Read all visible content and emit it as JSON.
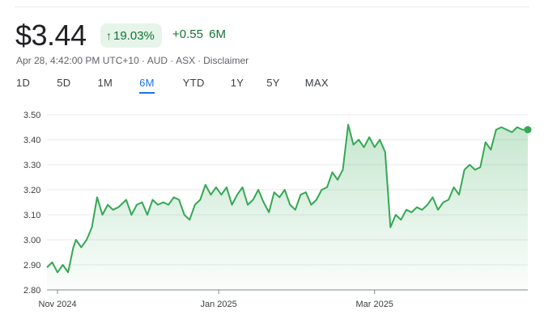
{
  "quote": {
    "price": "$3.44",
    "change_pct": "19.03%",
    "change_abs": "+0.55",
    "change_period": "6M",
    "timestamp": "Apr 28, 4:42:00 PM UTC+10",
    "currency": "AUD",
    "exchange": "ASX",
    "disclaimer": "Disclaimer",
    "up_arrow_icon": "arrow-up-icon"
  },
  "ranges": [
    {
      "label": "1D",
      "active": false
    },
    {
      "label": "5D",
      "active": false
    },
    {
      "label": "1M",
      "active": false
    },
    {
      "label": "6M",
      "active": true
    },
    {
      "label": "YTD",
      "active": false
    },
    {
      "label": "1Y",
      "active": false
    },
    {
      "label": "5Y",
      "active": false
    },
    {
      "label": "MAX",
      "active": false
    }
  ],
  "colors": {
    "line": "#34a853",
    "positive_text": "#137333",
    "badge_bg": "#e6f4ea",
    "active_tab": "#1a73e8",
    "grid": "#e8eaed"
  },
  "chart_data": {
    "type": "area",
    "ylim": [
      2.8,
      3.5
    ],
    "y_ticks": [
      "3.50",
      "3.40",
      "3.30",
      "3.20",
      "3.10",
      "3.00",
      "2.90",
      "2.80"
    ],
    "x_ticks": [
      {
        "label": "Nov 2024",
        "x": "2024-11-01"
      },
      {
        "label": "Jan 2025",
        "x": "2025-01-01"
      },
      {
        "label": "Mar 2025",
        "x": "2025-03-01"
      }
    ],
    "grid": "horizontal",
    "x_start": "2024-10-28",
    "x_end": "2025-04-28",
    "series": [
      {
        "x": [
          "2024-10-28",
          "2024-10-30",
          "2024-11-01",
          "2024-11-03",
          "2024-11-05",
          "2024-11-07",
          "2024-11-08",
          "2024-11-10",
          "2024-11-12",
          "2024-11-14",
          "2024-11-16",
          "2024-11-18",
          "2024-11-20",
          "2024-11-22",
          "2024-11-24",
          "2024-11-25",
          "2024-11-27",
          "2024-11-29",
          "2024-12-01",
          "2024-12-03",
          "2024-12-05",
          "2024-12-07",
          "2024-12-09",
          "2024-12-11",
          "2024-12-13",
          "2024-12-15",
          "2024-12-17",
          "2024-12-19",
          "2024-12-21",
          "2024-12-23",
          "2024-12-25",
          "2024-12-27",
          "2024-12-29",
          "2024-12-31",
          "2025-01-02",
          "2025-01-04",
          "2025-01-06",
          "2025-01-08",
          "2025-01-10",
          "2025-01-12",
          "2025-01-14",
          "2025-01-16",
          "2025-01-18",
          "2025-01-20",
          "2025-01-22",
          "2025-01-24",
          "2025-01-26",
          "2025-01-28",
          "2025-01-30",
          "2025-02-01",
          "2025-02-03",
          "2025-02-05",
          "2025-02-07",
          "2025-02-09",
          "2025-02-11",
          "2025-02-13",
          "2025-02-15",
          "2025-02-17",
          "2025-02-19",
          "2025-02-21",
          "2025-02-23",
          "2025-02-25",
          "2025-02-27",
          "2025-03-01",
          "2025-03-03",
          "2025-03-05",
          "2025-03-07",
          "2025-03-09",
          "2025-03-11",
          "2025-03-13",
          "2025-03-15",
          "2025-03-17",
          "2025-03-19",
          "2025-03-21",
          "2025-03-23",
          "2025-03-25",
          "2025-03-27",
          "2025-03-29",
          "2025-03-31",
          "2025-04-02",
          "2025-04-04",
          "2025-04-06",
          "2025-04-08",
          "2025-04-10",
          "2025-04-12",
          "2025-04-14",
          "2025-04-16",
          "2025-04-18",
          "2025-04-20",
          "2025-04-22",
          "2025-04-24",
          "2025-04-26",
          "2025-04-28"
        ],
        "y": [
          2.89,
          2.91,
          2.87,
          2.9,
          2.87,
          2.97,
          3.0,
          2.97,
          3.0,
          3.05,
          3.17,
          3.1,
          3.14,
          3.12,
          3.13,
          3.14,
          3.16,
          3.1,
          3.14,
          3.15,
          3.1,
          3.16,
          3.14,
          3.15,
          3.14,
          3.17,
          3.16,
          3.1,
          3.08,
          3.14,
          3.16,
          3.22,
          3.18,
          3.21,
          3.18,
          3.21,
          3.14,
          3.18,
          3.21,
          3.14,
          3.16,
          3.2,
          3.15,
          3.11,
          3.19,
          3.17,
          3.2,
          3.14,
          3.12,
          3.18,
          3.19,
          3.14,
          3.16,
          3.2,
          3.21,
          3.27,
          3.24,
          3.28,
          3.46,
          3.38,
          3.4,
          3.37,
          3.41,
          3.37,
          3.4,
          3.35,
          3.05,
          3.1,
          3.08,
          3.12,
          3.11,
          3.13,
          3.12,
          3.14,
          3.17,
          3.12,
          3.15,
          3.16,
          3.21,
          3.18,
          3.28,
          3.3,
          3.28,
          3.29,
          3.39,
          3.36,
          3.44,
          3.45,
          3.44,
          3.43,
          3.45,
          3.44,
          3.44
        ]
      }
    ]
  }
}
